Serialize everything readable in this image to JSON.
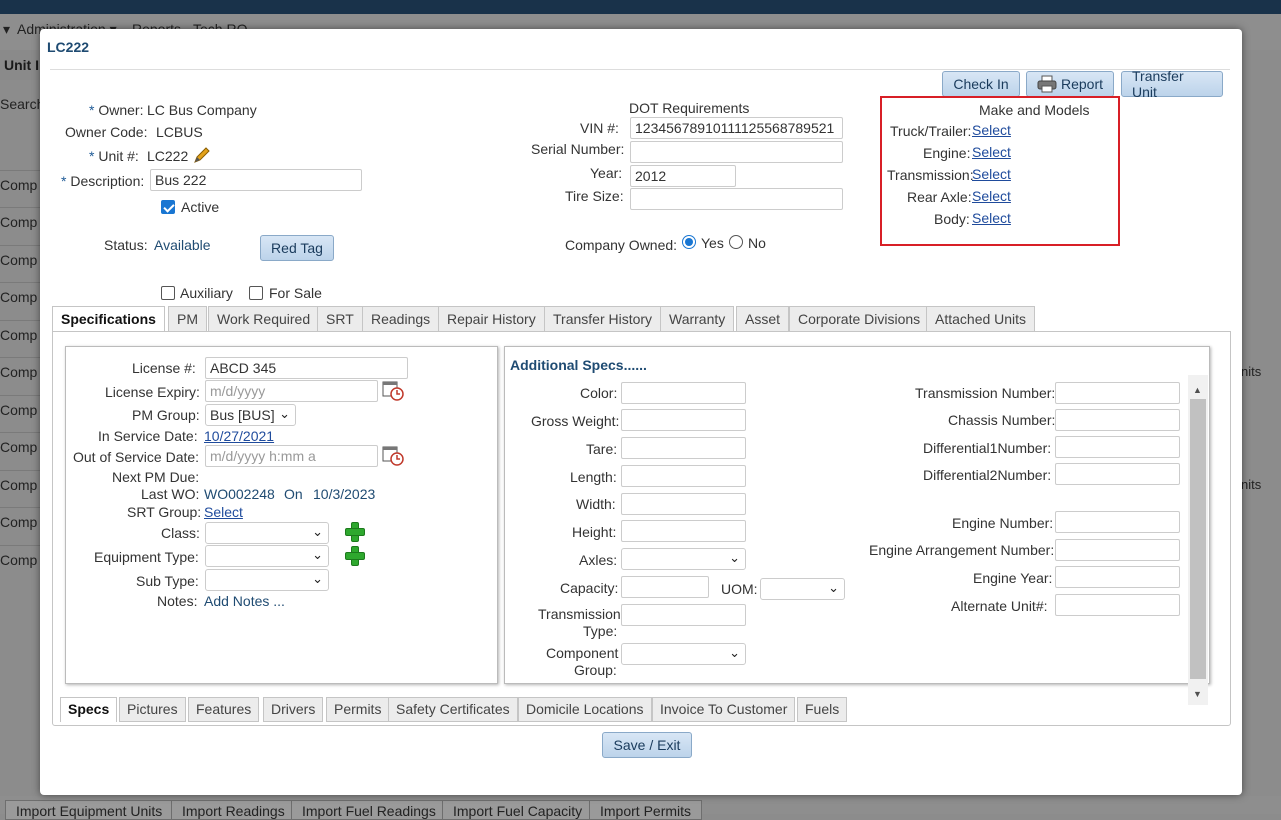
{
  "background": {
    "menu": [
      "Administration ▾",
      "Reports",
      "Tech RO"
    ],
    "page_title": "Unit I",
    "search_label": "Search",
    "row_label": "Comp",
    "right_text": "nits",
    "bottom_tabs": [
      "Import Equipment Units",
      "Import Readings",
      "Import Fuel Readings",
      "Import Fuel Capacity",
      "Import Permits"
    ]
  },
  "modal": {
    "title": "LC222",
    "buttons": {
      "check_in": "Check In",
      "report": "Report",
      "transfer_unit": "Transfer Unit"
    },
    "owner": {
      "label": "Owner:",
      "value": "LC Bus Company"
    },
    "owner_code": {
      "label": "Owner Code:",
      "value": "LCBUS"
    },
    "unit": {
      "label": "Unit #:",
      "value": "LC222"
    },
    "description": {
      "label": "Description:",
      "value": "Bus 222"
    },
    "active_label": "Active",
    "status": {
      "label": "Status:",
      "value": "Available"
    },
    "red_tag": "Red Tag",
    "auxiliary_label": "Auxiliary",
    "for_sale_label": "For Sale",
    "dot": {
      "heading": "DOT Requirements",
      "vin_label": "VIN #:",
      "vin_value": "12345678910111125568789521",
      "serial_label": "Serial Number:",
      "serial_value": "",
      "year_label": "Year:",
      "year_value": "2012",
      "tire_label": "Tire Size:",
      "tire_value": ""
    },
    "company_owned": {
      "label": "Company Owned:",
      "yes": "Yes",
      "no": "No"
    },
    "make_models": {
      "heading": "Make and Models",
      "rows": [
        {
          "label": "Truck/Trailer:",
          "link": "Select"
        },
        {
          "label": "Engine:",
          "link": "Select"
        },
        {
          "label": "Transmission:",
          "link": "Select"
        },
        {
          "label": "Rear Axle:",
          "link": "Select"
        },
        {
          "label": "Body:",
          "link": "Select"
        }
      ]
    },
    "tabs": [
      "Specifications",
      "PM",
      "Work Required",
      "SRT",
      "Readings",
      "Repair History",
      "Transfer History",
      "Warranty",
      "Asset",
      "Corporate Divisions",
      "Attached Units"
    ],
    "spec": {
      "license_label": "License #:",
      "license_value": "ABCD 345",
      "license_expiry_label": "License Expiry:",
      "license_expiry_placeholder": "m/d/yyyy",
      "pm_group_label": "PM Group:",
      "pm_group_value": "Bus [BUS]",
      "in_service_label": "In Service Date:",
      "in_service_value": "10/27/2021",
      "out_service_label": "Out of Service Date:",
      "out_service_placeholder": "m/d/yyyy h:mm a",
      "next_pm_label": "Next PM Due:",
      "last_wo_label": "Last WO:",
      "last_wo_value": "WO002248",
      "on_label": "On",
      "last_wo_date": "10/3/2023",
      "srt_group_label": "SRT Group:",
      "srt_group_link": "Select",
      "class_label": "Class:",
      "equipment_type_label": "Equipment Type:",
      "sub_type_label": "Sub Type:",
      "notes_label": "Notes:",
      "notes_link": "Add Notes ..."
    },
    "additional": {
      "heading": "Additional Specs......",
      "color_label": "Color:",
      "gross_weight_label": "Gross Weight:",
      "tare_label": "Tare:",
      "length_label": "Length:",
      "width_label": "Width:",
      "height_label": "Height:",
      "axles_label": "Axles:",
      "capacity_label": "Capacity:",
      "uom_label": "UOM:",
      "transmission_type_label_1": "Transmission",
      "transmission_type_label_2": "Type:",
      "component_group_label_1": "Component",
      "component_group_label_2": "Group:",
      "transmission_number_label": "Transmission Number:",
      "chassis_number_label": "Chassis Number:",
      "diff1_label": "Differential1Number:",
      "diff2_label": "Differential2Number:",
      "engine_number_label": "Engine Number:",
      "engine_arrangement_label": "Engine Arrangement Number:",
      "engine_year_label": "Engine Year:",
      "alternate_unit_label": "Alternate Unit#:"
    },
    "sub_tabs": [
      "Specs",
      "Pictures",
      "Features",
      "Drivers",
      "Permits",
      "Safety Certificates",
      "Domicile Locations",
      "Invoice To Customer",
      "Fuels"
    ],
    "save_exit": "Save / Exit"
  }
}
